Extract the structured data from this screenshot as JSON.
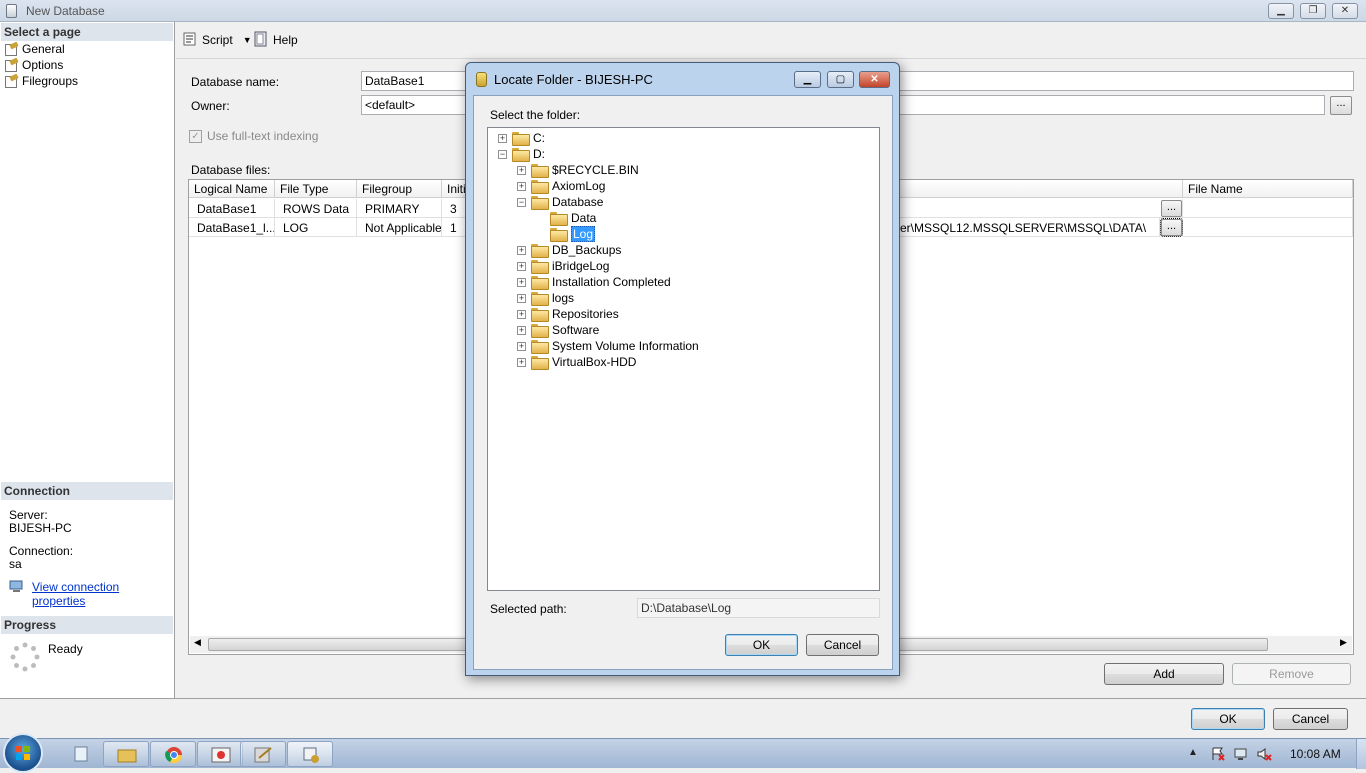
{
  "window": {
    "title": "New Database"
  },
  "left_panel": {
    "select_page_header": "Select a page",
    "pages": [
      "General",
      "Options",
      "Filegroups"
    ],
    "connection_header": "Connection",
    "server_label": "Server:",
    "server_value": "BIJESH-PC",
    "connection_label": "Connection:",
    "connection_value": "sa",
    "view_connection_link": "View connection properties",
    "progress_header": "Progress",
    "progress_status": "Ready"
  },
  "toolbar": {
    "script_label": "Script",
    "help_label": "Help"
  },
  "form": {
    "database_name_label": "Database name:",
    "database_name_value": "DataBase1",
    "owner_label": "Owner:",
    "owner_value": "<default>",
    "fulltext_label": "Use full-text indexing",
    "database_files_label": "Database files:"
  },
  "grid": {
    "columns": [
      "Logical Name",
      "File Type",
      "Filegroup",
      "Initia",
      "File Name"
    ],
    "rows": [
      {
        "logical_name": "DataBase1",
        "file_type": "ROWS Data",
        "filegroup": "PRIMARY",
        "initial": "3",
        "path": ""
      },
      {
        "logical_name": "DataBase1_l...",
        "file_type": "LOG",
        "filegroup": "Not Applicable",
        "initial": "1",
        "path": "er\\MSSQL12.MSSQLSERVER\\MSSQL\\DATA\\"
      }
    ],
    "browse_label": "..."
  },
  "buttons": {
    "add": "Add",
    "remove": "Remove",
    "ok": "OK",
    "cancel": "Cancel"
  },
  "dialog": {
    "title": "Locate Folder - BIJESH-PC",
    "select_folder_label": "Select the folder:",
    "tree": [
      {
        "label": "C:",
        "level": 0,
        "expander": "+"
      },
      {
        "label": "D:",
        "level": 0,
        "expander": "-"
      },
      {
        "label": "$RECYCLE.BIN",
        "level": 1,
        "expander": "+"
      },
      {
        "label": "AxiomLog",
        "level": 1,
        "expander": "+"
      },
      {
        "label": "Database",
        "level": 1,
        "expander": "-"
      },
      {
        "label": "Data",
        "level": 2,
        "expander": ""
      },
      {
        "label": "Log",
        "level": 2,
        "expander": "",
        "selected": true
      },
      {
        "label": "DB_Backups",
        "level": 1,
        "expander": "+"
      },
      {
        "label": "iBridgeLog",
        "level": 1,
        "expander": "+"
      },
      {
        "label": "Installation Completed",
        "level": 1,
        "expander": "+"
      },
      {
        "label": "logs",
        "level": 1,
        "expander": "+"
      },
      {
        "label": "Repositories",
        "level": 1,
        "expander": "+"
      },
      {
        "label": "Software",
        "level": 1,
        "expander": "+"
      },
      {
        "label": "System Volume Information",
        "level": 1,
        "expander": "+"
      },
      {
        "label": "VirtualBox-HDD",
        "level": 1,
        "expander": "+"
      }
    ],
    "selected_path_label": "Selected path:",
    "selected_path_value": "D:\\Database\\Log",
    "ok_label": "OK",
    "cancel_label": "Cancel"
  },
  "taskbar": {
    "clock": "10:08 AM"
  }
}
